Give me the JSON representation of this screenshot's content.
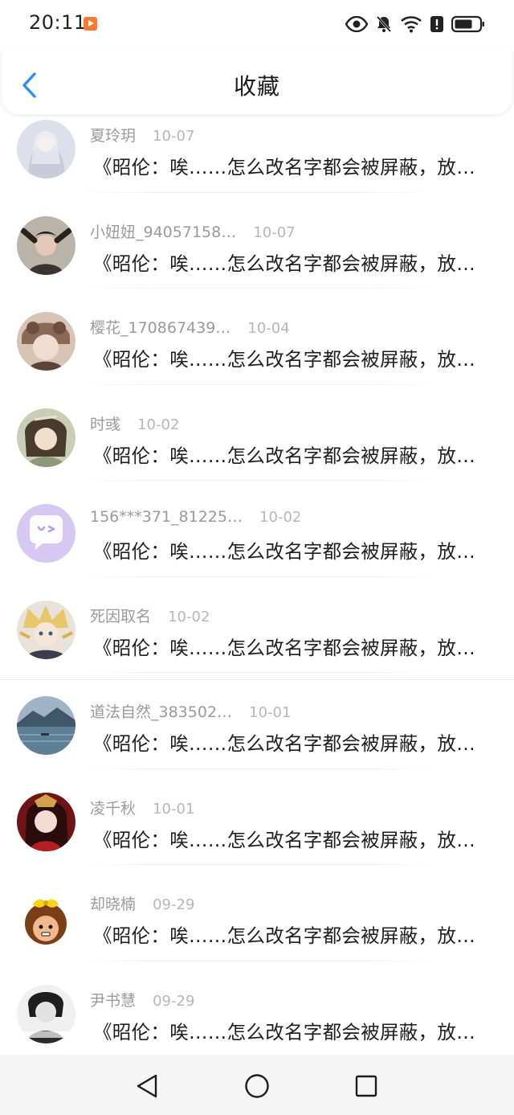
{
  "status_bar": {
    "time": "20:11",
    "icons": [
      "eye-icon",
      "bell-muted-icon",
      "wifi-icon",
      "alert-icon",
      "battery-icon"
    ]
  },
  "header": {
    "title": "收藏",
    "back_icon": "chevron-left-icon",
    "accent_color": "#2b8ef0"
  },
  "favorites": [
    {
      "username": "夏玲玥",
      "date": "10-07",
      "preview": "《昭伦：唉……怎么改名字都会被屏蔽，放…"
    },
    {
      "username": "小妞妞_94057158…",
      "date": "10-07",
      "preview": "《昭伦：唉……怎么改名字都会被屏蔽，放…"
    },
    {
      "username": "樱花_170867439…",
      "date": "10-04",
      "preview": "《昭伦：唉……怎么改名字都会被屏蔽，放…"
    },
    {
      "username": "时彧",
      "date": "10-02",
      "preview": "《昭伦：唉……怎么改名字都会被屏蔽，放…"
    },
    {
      "username": "156***371_81225…",
      "date": "10-02",
      "preview": "《昭伦：唉……怎么改名字都会被屏蔽，放…"
    },
    {
      "username": "死因取名",
      "date": "10-02",
      "preview": "《昭伦：唉……怎么改名字都会被屏蔽，放…"
    },
    {
      "username": "道法自然_383502…",
      "date": "10-01",
      "preview": "《昭伦：唉……怎么改名字都会被屏蔽，放…"
    },
    {
      "username": "凌千秋",
      "date": "10-01",
      "preview": "《昭伦：唉……怎么改名字都会被屏蔽，放…"
    },
    {
      "username": "却晓楠",
      "date": "09-29",
      "preview": "《昭伦：唉……怎么改名字都会被屏蔽，放…"
    },
    {
      "username": "尹书慧",
      "date": "09-29",
      "preview": "《昭伦：唉……怎么改名字都会被屏蔽，放…"
    }
  ],
  "nav_bar": {
    "buttons": [
      "nav-back-icon",
      "nav-home-icon",
      "nav-recents-icon"
    ]
  }
}
